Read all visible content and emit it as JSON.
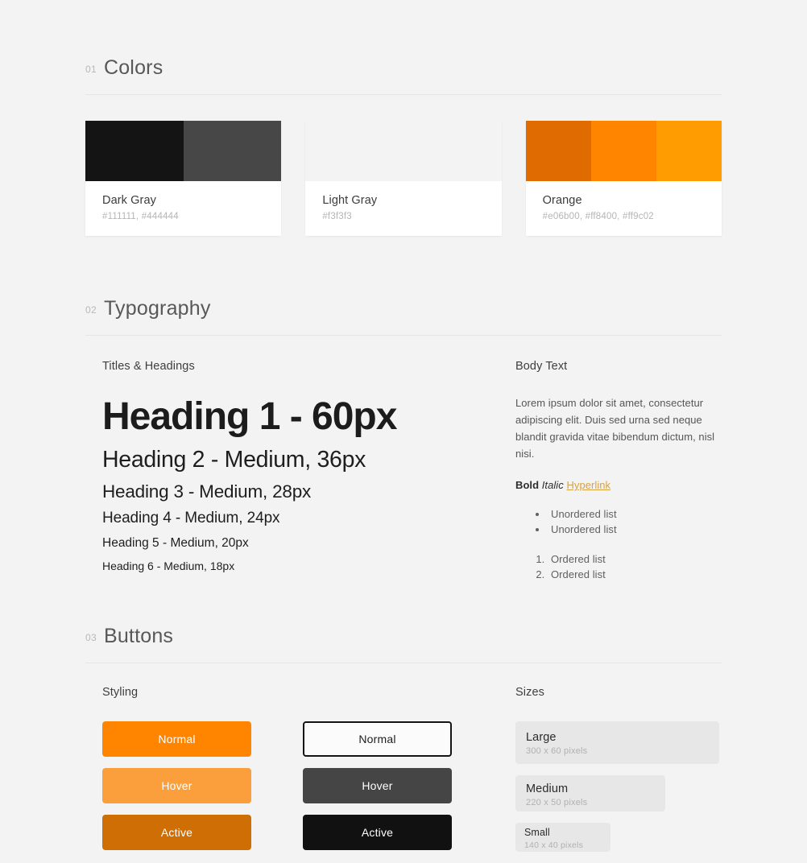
{
  "sections": {
    "colors": {
      "number": "01",
      "title": "Colors",
      "cards": [
        {
          "name": "Dark Gray",
          "hexes_label": "#111111, #444444",
          "swatches": [
            "#141414",
            "#474747"
          ]
        },
        {
          "name": "Light Gray",
          "hexes_label": "#f3f3f3",
          "swatches": [
            "#f3f3f3"
          ]
        },
        {
          "name": "Orange",
          "hexes_label": "#e06b00, #ff8400, #ff9c02",
          "swatches": [
            "#e06b00",
            "#ff8400",
            "#ff9c02"
          ]
        }
      ]
    },
    "typography": {
      "number": "02",
      "title": "Typography",
      "left_label": "Titles & Headings",
      "right_label": "Body Text",
      "headings": [
        "Heading 1 - 60px",
        "Heading 2 - Medium, 36px",
        "Heading 3 - Medium, 28px",
        "Heading 4 - Medium, 24px",
        "Heading 5 - Medium, 20px",
        "Heading 6 - Medium, 18px"
      ],
      "paragraph": "Lorem ipsum dolor sit amet, consectetur adipiscing elit. Duis sed urna sed neque blandit gravida vitae bibendum dictum, nisl nisi.",
      "inline": {
        "bold": "Bold",
        "italic": "Italic",
        "hyperlink": "Hyperlink",
        "hyperlink_color": "#d8a33f"
      },
      "unordered": [
        "Unordered list",
        "Unordered list"
      ],
      "ordered": [
        "Ordered list",
        "Ordered list"
      ]
    },
    "buttons": {
      "number": "03",
      "title": "Buttons",
      "styling_label": "Styling",
      "sizes_label": "Sizes",
      "orange_column": [
        {
          "label": "Normal",
          "color": "#ff8400"
        },
        {
          "label": "Hover",
          "color": "#fa9f3c"
        },
        {
          "label": "Active",
          "color": "#cf6e04"
        }
      ],
      "dark_column": [
        {
          "label": "Normal",
          "color": "#fbfbfb"
        },
        {
          "label": "Hover",
          "color": "#454545"
        },
        {
          "label": "Active",
          "color": "#111111"
        }
      ],
      "sizes": [
        {
          "name": "Large",
          "dims": "300 x 60 pixels"
        },
        {
          "name": "Medium",
          "dims": "220 x 50 pixels"
        },
        {
          "name": "Small",
          "dims": "140 x 40 pixels"
        }
      ]
    }
  }
}
